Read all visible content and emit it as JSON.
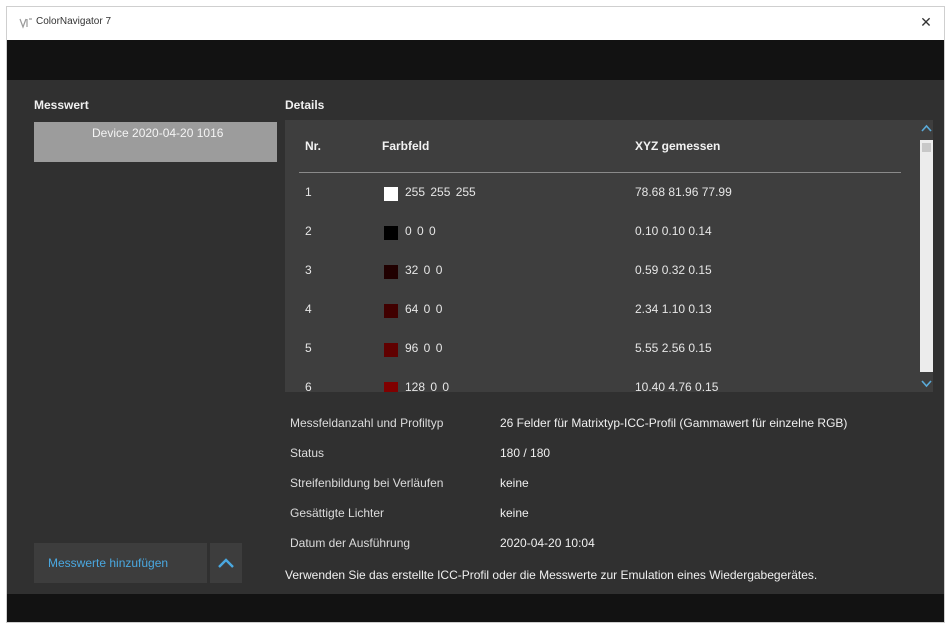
{
  "window": {
    "title": "ColorNavigator 7",
    "close_glyph": "✕"
  },
  "left": {
    "heading": "Messwert",
    "items": [
      {
        "label": "Device 2020-04-20 1016"
      }
    ],
    "add_button_label": "Messwerte hinzufügen"
  },
  "details": {
    "heading": "Details",
    "table": {
      "headers": {
        "nr": "Nr.",
        "farbfeld": "Farbfeld",
        "xyz": "XYZ gemessen"
      },
      "rows": [
        {
          "nr": "1",
          "rgb": "255 255 255",
          "xyz": "78.68 81.96 77.99",
          "swatch": "#ffffff"
        },
        {
          "nr": "2",
          "rgb": "0 0 0",
          "xyz": "0.10 0.10 0.14",
          "swatch": "#000000"
        },
        {
          "nr": "3",
          "rgb": "32 0 0",
          "xyz": "0.59 0.32 0.15",
          "swatch": "#200000"
        },
        {
          "nr": "4",
          "rgb": "64 0 0",
          "xyz": "2.34 1.10 0.13",
          "swatch": "#400000"
        },
        {
          "nr": "5",
          "rgb": "96 0 0",
          "xyz": "5.55 2.56 0.15",
          "swatch": "#600000"
        },
        {
          "nr": "6",
          "rgb": "128 0 0",
          "xyz": "10.40 4.76 0.15",
          "swatch": "#800000"
        }
      ]
    },
    "info": [
      {
        "label": "Messfeldanzahl und Profiltyp",
        "value": "26 Felder für Matrixtyp-ICC-Profil (Gammawert für einzelne RGB)"
      },
      {
        "label": "Status",
        "value": "180 / 180"
      },
      {
        "label": "Streifenbildung bei Verläufen",
        "value": "keine"
      },
      {
        "label": "Gesättigte Lichter",
        "value": "keine"
      },
      {
        "label": "Datum der Ausführung",
        "value": "2020-04-20 10:04"
      }
    ],
    "footer": "Verwenden Sie das erstellte ICC-Profil oder die Messwerte zur Emulation eines Wiedergabegerätes."
  },
  "colors": {
    "accent": "#4aa8e0",
    "panel": "#303030",
    "table_bg": "#3e3e3e",
    "selected_item": "#9c9c9c"
  },
  "icons": {
    "up": "chevron-up-icon",
    "scroll_up": "scroll-up-arrow-icon",
    "scroll_down": "scroll-down-arrow-icon"
  }
}
